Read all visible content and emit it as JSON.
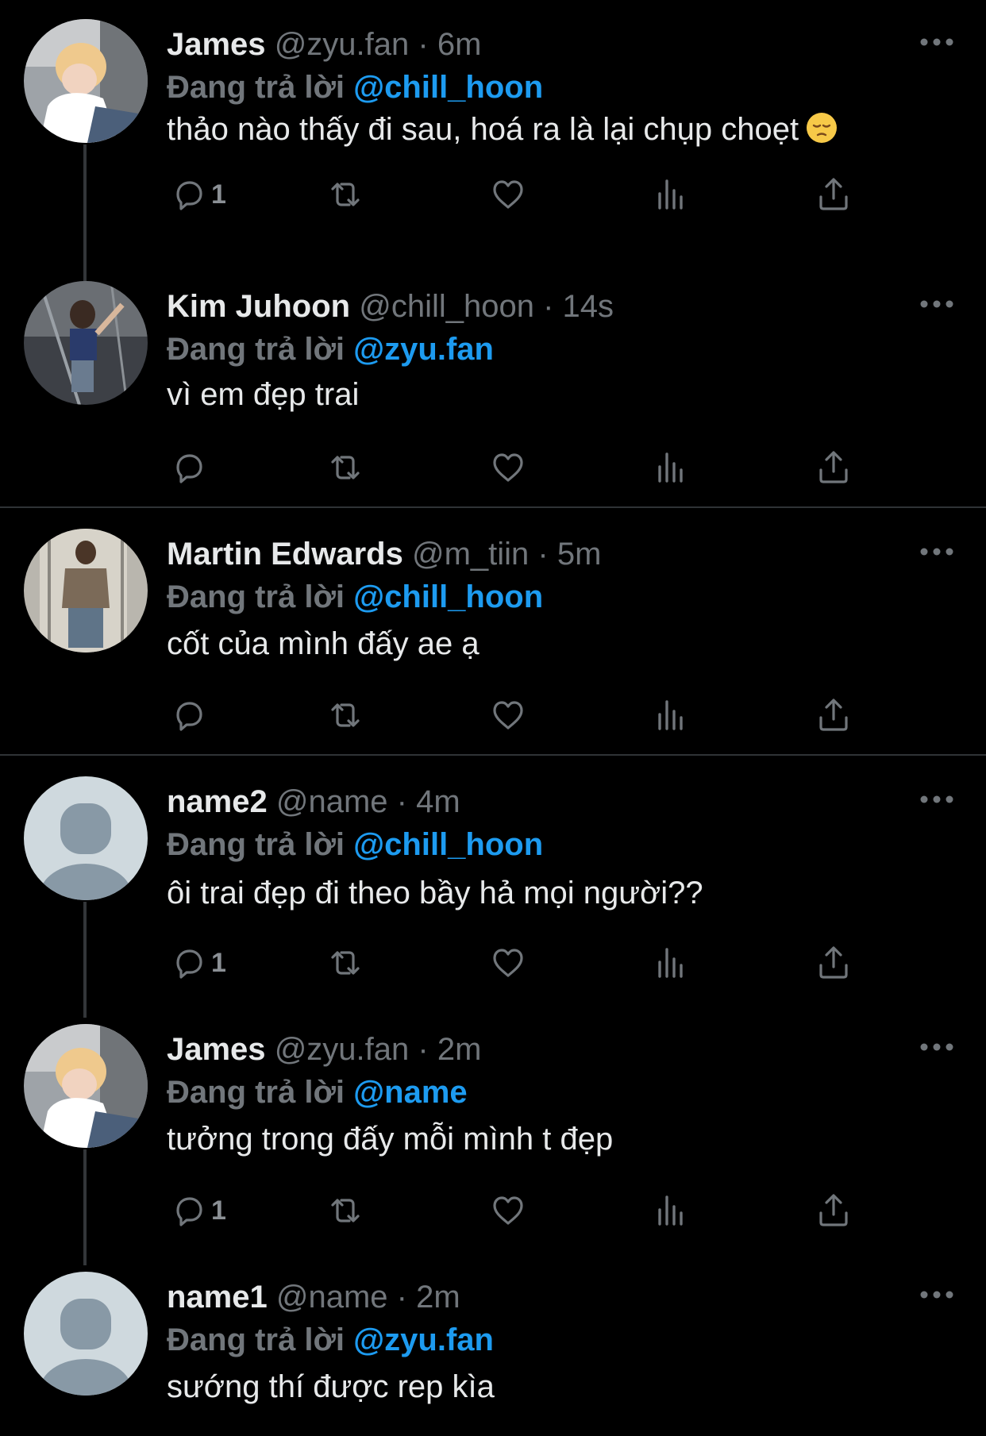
{
  "colors": {
    "background": "#000000",
    "text": "#e7e9ea",
    "muted": "#71767b",
    "link": "#1d9bf0",
    "divider": "#2f3336"
  },
  "reply_prefix": "Đang trả lời",
  "tweets": [
    {
      "name": "James",
      "handle": "@zyu.fan",
      "dot": "·",
      "time": "6m",
      "reply_to": "@chill_hoon",
      "text": "thảo nào thấy đi sau, hoá ra là lại chụp choẹt",
      "emoji": "pensive-face-icon",
      "reply_count": "1"
    },
    {
      "name": "Kim Juhoon",
      "handle": "@chill_hoon",
      "dot": "·",
      "time": "14s",
      "reply_to": "@zyu.fan",
      "text": "vì em đẹp trai",
      "reply_count": ""
    },
    {
      "name": "Martin Edwards",
      "handle": "@m_tiin",
      "dot": "·",
      "time": "5m",
      "reply_to": "@chill_hoon",
      "text": "cốt của mình đấy ae ạ",
      "reply_count": ""
    },
    {
      "name": "name2",
      "handle": "@name",
      "dot": "·",
      "time": "4m",
      "reply_to": "@chill_hoon",
      "text": "ôi trai đẹp đi theo bầy hả mọi người??",
      "reply_count": "1"
    },
    {
      "name": "James",
      "handle": "@zyu.fan",
      "dot": "·",
      "time": "2m",
      "reply_to": "@name",
      "text": "tưởng trong đấy mỗi mình t đẹp",
      "reply_count": "1"
    },
    {
      "name": "name1",
      "handle": "@name",
      "dot": "·",
      "time": "2m",
      "reply_to": "@zyu.fan",
      "text": "sướng thí được rep kìa"
    }
  ],
  "icons": {
    "reply": "reply-icon",
    "retweet": "retweet-icon",
    "like": "heart-icon",
    "views": "views-icon",
    "share": "share-icon",
    "more": "more-icon"
  }
}
